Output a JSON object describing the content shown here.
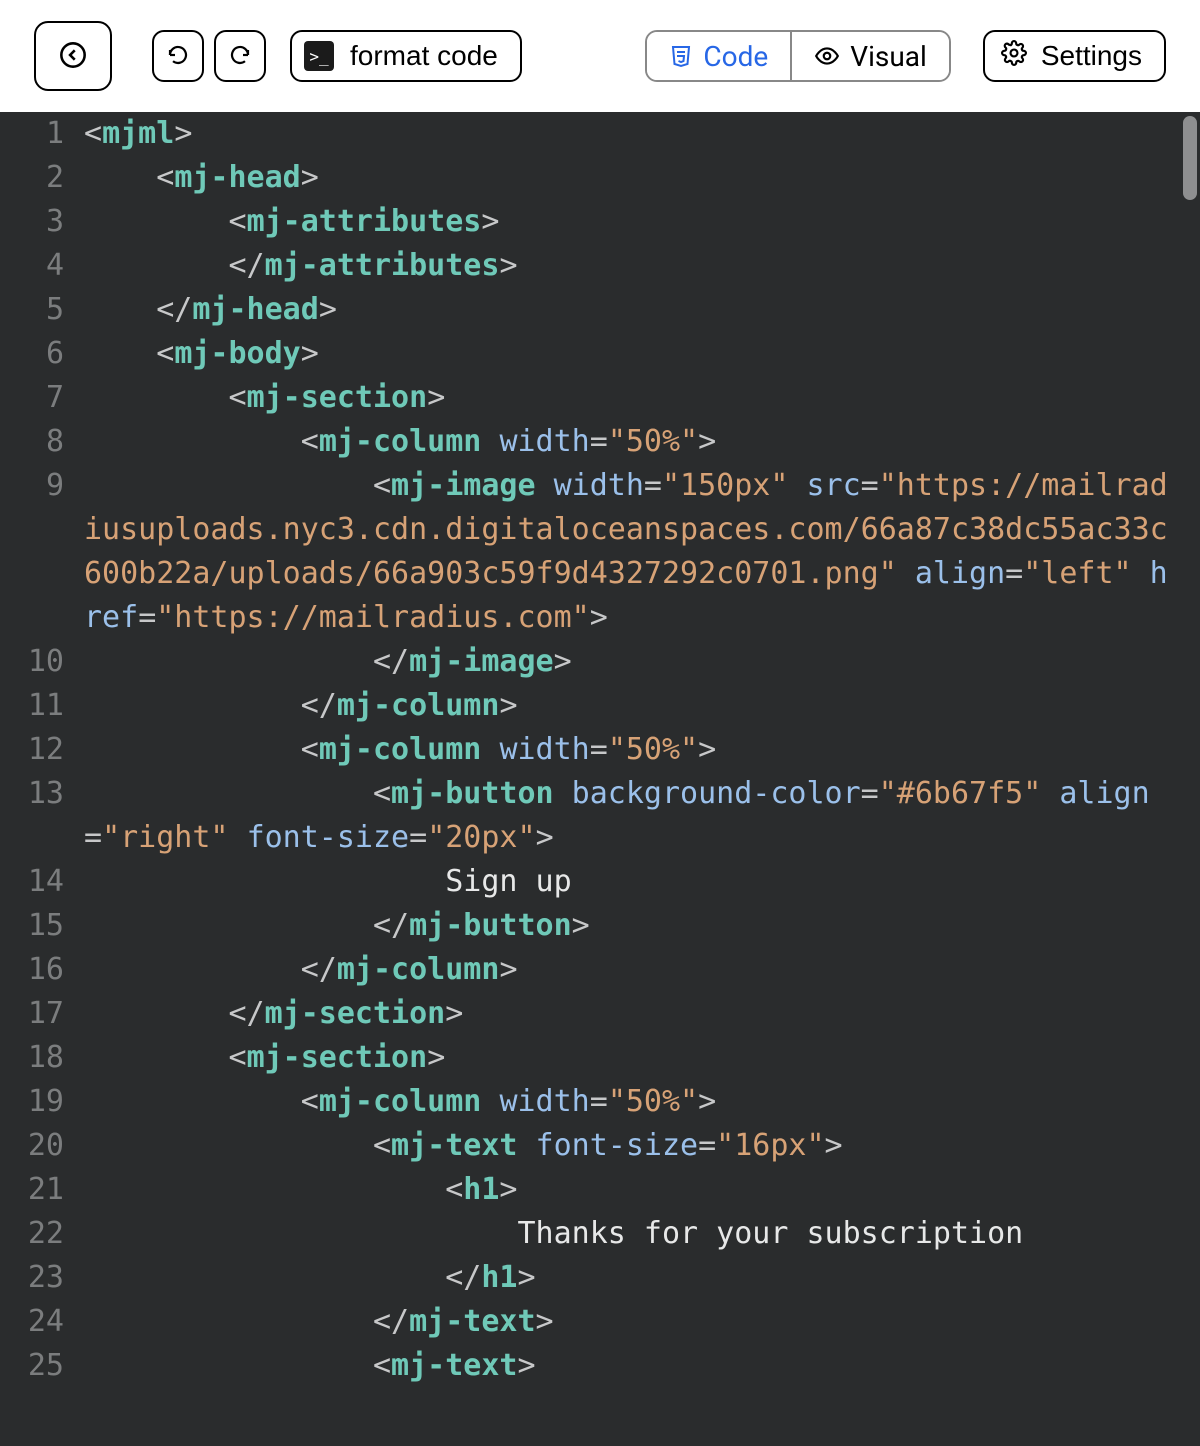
{
  "toolbar": {
    "format_label": "format code",
    "code_label": "Code",
    "visual_label": "Visual",
    "settings_label": "Settings"
  },
  "code": {
    "lines": [
      {
        "n": 1,
        "segs": [
          {
            "c": "p",
            "t": "<"
          },
          {
            "c": "tg",
            "t": "mjml"
          },
          {
            "c": "p",
            "t": ">"
          }
        ]
      },
      {
        "n": 2,
        "segs": [
          {
            "c": "tx",
            "t": "    "
          },
          {
            "c": "p",
            "t": "<"
          },
          {
            "c": "tg",
            "t": "mj-head"
          },
          {
            "c": "p",
            "t": ">"
          }
        ]
      },
      {
        "n": 3,
        "segs": [
          {
            "c": "tx",
            "t": "        "
          },
          {
            "c": "p",
            "t": "<"
          },
          {
            "c": "tg",
            "t": "mj-attributes"
          },
          {
            "c": "p",
            "t": ">"
          }
        ]
      },
      {
        "n": 4,
        "segs": [
          {
            "c": "tx",
            "t": "        "
          },
          {
            "c": "p",
            "t": "</"
          },
          {
            "c": "tg",
            "t": "mj-attributes"
          },
          {
            "c": "p",
            "t": ">"
          }
        ]
      },
      {
        "n": 5,
        "segs": [
          {
            "c": "tx",
            "t": "    "
          },
          {
            "c": "p",
            "t": "</"
          },
          {
            "c": "tg",
            "t": "mj-head"
          },
          {
            "c": "p",
            "t": ">"
          }
        ]
      },
      {
        "n": 6,
        "segs": [
          {
            "c": "tx",
            "t": "    "
          },
          {
            "c": "p",
            "t": "<"
          },
          {
            "c": "tg",
            "t": "mj-body"
          },
          {
            "c": "p",
            "t": ">"
          }
        ]
      },
      {
        "n": 7,
        "segs": [
          {
            "c": "tx",
            "t": "        "
          },
          {
            "c": "p",
            "t": "<"
          },
          {
            "c": "tg",
            "t": "mj-section"
          },
          {
            "c": "p",
            "t": ">"
          }
        ]
      },
      {
        "n": 8,
        "segs": [
          {
            "c": "tx",
            "t": "            "
          },
          {
            "c": "p",
            "t": "<"
          },
          {
            "c": "tg",
            "t": "mj-column"
          },
          {
            "c": "tx",
            "t": " "
          },
          {
            "c": "at",
            "t": "width"
          },
          {
            "c": "p",
            "t": "="
          },
          {
            "c": "st",
            "t": "\"50%\""
          },
          {
            "c": "p",
            "t": ">"
          }
        ]
      },
      {
        "n": 9,
        "segs": [
          {
            "c": "tx",
            "t": "                "
          },
          {
            "c": "p",
            "t": "<"
          },
          {
            "c": "tg",
            "t": "mj-image"
          },
          {
            "c": "tx",
            "t": " "
          },
          {
            "c": "at",
            "t": "width"
          },
          {
            "c": "p",
            "t": "="
          },
          {
            "c": "st",
            "t": "\"150px\""
          },
          {
            "c": "tx",
            "t": " "
          },
          {
            "c": "at",
            "t": "src"
          },
          {
            "c": "p",
            "t": "="
          },
          {
            "c": "st",
            "t": "\"https://mailradiusuploads.nyc3.cdn.digitaloceanspaces.com/66a87c38dc55ac33c600b22a/uploads/66a903c59f9d4327292c0701.png\""
          },
          {
            "c": "tx",
            "t": " "
          },
          {
            "c": "at",
            "t": "align"
          },
          {
            "c": "p",
            "t": "="
          },
          {
            "c": "st",
            "t": "\"left\""
          },
          {
            "c": "tx",
            "t": " "
          },
          {
            "c": "at",
            "t": "href"
          },
          {
            "c": "p",
            "t": "="
          },
          {
            "c": "st",
            "t": "\"https://mailradius.com\""
          },
          {
            "c": "p",
            "t": ">"
          }
        ]
      },
      {
        "n": 10,
        "segs": [
          {
            "c": "tx",
            "t": "                "
          },
          {
            "c": "p",
            "t": "</"
          },
          {
            "c": "tg",
            "t": "mj-image"
          },
          {
            "c": "p",
            "t": ">"
          }
        ]
      },
      {
        "n": 11,
        "segs": [
          {
            "c": "tx",
            "t": "            "
          },
          {
            "c": "p",
            "t": "</"
          },
          {
            "c": "tg",
            "t": "mj-column"
          },
          {
            "c": "p",
            "t": ">"
          }
        ]
      },
      {
        "n": 12,
        "segs": [
          {
            "c": "tx",
            "t": "            "
          },
          {
            "c": "p",
            "t": "<"
          },
          {
            "c": "tg",
            "t": "mj-column"
          },
          {
            "c": "tx",
            "t": " "
          },
          {
            "c": "at",
            "t": "width"
          },
          {
            "c": "p",
            "t": "="
          },
          {
            "c": "st",
            "t": "\"50%\""
          },
          {
            "c": "p",
            "t": ">"
          }
        ]
      },
      {
        "n": 13,
        "segs": [
          {
            "c": "tx",
            "t": "                "
          },
          {
            "c": "p",
            "t": "<"
          },
          {
            "c": "tg",
            "t": "mj-button"
          },
          {
            "c": "tx",
            "t": " "
          },
          {
            "c": "at",
            "t": "background-color"
          },
          {
            "c": "p",
            "t": "="
          },
          {
            "c": "st",
            "t": "\"#6b67f5\""
          },
          {
            "c": "tx",
            "t": " "
          },
          {
            "c": "at",
            "t": "align"
          },
          {
            "c": "p",
            "t": "="
          },
          {
            "c": "st",
            "t": "\"right\""
          },
          {
            "c": "tx",
            "t": " "
          },
          {
            "c": "at",
            "t": "font-size"
          },
          {
            "c": "p",
            "t": "="
          },
          {
            "c": "st",
            "t": "\"20px\""
          },
          {
            "c": "p",
            "t": ">"
          }
        ]
      },
      {
        "n": 14,
        "segs": [
          {
            "c": "tx",
            "t": "                    Sign up"
          }
        ]
      },
      {
        "n": 15,
        "segs": [
          {
            "c": "tx",
            "t": "                "
          },
          {
            "c": "p",
            "t": "</"
          },
          {
            "c": "tg",
            "t": "mj-button"
          },
          {
            "c": "p",
            "t": ">"
          }
        ]
      },
      {
        "n": 16,
        "segs": [
          {
            "c": "tx",
            "t": "            "
          },
          {
            "c": "p",
            "t": "</"
          },
          {
            "c": "tg",
            "t": "mj-column"
          },
          {
            "c": "p",
            "t": ">"
          }
        ]
      },
      {
        "n": 17,
        "segs": [
          {
            "c": "tx",
            "t": "        "
          },
          {
            "c": "p",
            "t": "</"
          },
          {
            "c": "tg",
            "t": "mj-section"
          },
          {
            "c": "p",
            "t": ">"
          }
        ]
      },
      {
        "n": 18,
        "segs": [
          {
            "c": "tx",
            "t": "        "
          },
          {
            "c": "p",
            "t": "<"
          },
          {
            "c": "tg",
            "t": "mj-section"
          },
          {
            "c": "p",
            "t": ">"
          }
        ]
      },
      {
        "n": 19,
        "segs": [
          {
            "c": "tx",
            "t": "            "
          },
          {
            "c": "p",
            "t": "<"
          },
          {
            "c": "tg",
            "t": "mj-column"
          },
          {
            "c": "tx",
            "t": " "
          },
          {
            "c": "at",
            "t": "width"
          },
          {
            "c": "p",
            "t": "="
          },
          {
            "c": "st",
            "t": "\"50%\""
          },
          {
            "c": "p",
            "t": ">"
          }
        ]
      },
      {
        "n": 20,
        "segs": [
          {
            "c": "tx",
            "t": "                "
          },
          {
            "c": "p",
            "t": "<"
          },
          {
            "c": "tg",
            "t": "mj-text"
          },
          {
            "c": "tx",
            "t": " "
          },
          {
            "c": "at",
            "t": "font-size"
          },
          {
            "c": "p",
            "t": "="
          },
          {
            "c": "st",
            "t": "\"16px\""
          },
          {
            "c": "p",
            "t": ">"
          }
        ]
      },
      {
        "n": 21,
        "segs": [
          {
            "c": "tx",
            "t": "                    "
          },
          {
            "c": "p",
            "t": "<"
          },
          {
            "c": "tg",
            "t": "h1"
          },
          {
            "c": "p",
            "t": ">"
          }
        ]
      },
      {
        "n": 22,
        "segs": [
          {
            "c": "tx",
            "t": "                        Thanks for your subscription"
          }
        ]
      },
      {
        "n": 23,
        "segs": [
          {
            "c": "tx",
            "t": "                    "
          },
          {
            "c": "p",
            "t": "</"
          },
          {
            "c": "tg",
            "t": "h1"
          },
          {
            "c": "p",
            "t": ">"
          }
        ]
      },
      {
        "n": 24,
        "segs": [
          {
            "c": "tx",
            "t": "                "
          },
          {
            "c": "p",
            "t": "</"
          },
          {
            "c": "tg",
            "t": "mj-text"
          },
          {
            "c": "p",
            "t": ">"
          }
        ]
      },
      {
        "n": 25,
        "segs": [
          {
            "c": "tx",
            "t": "                "
          },
          {
            "c": "p",
            "t": "<"
          },
          {
            "c": "tg",
            "t": "mj-text"
          },
          {
            "c": "p",
            "t": ">"
          }
        ]
      }
    ]
  }
}
